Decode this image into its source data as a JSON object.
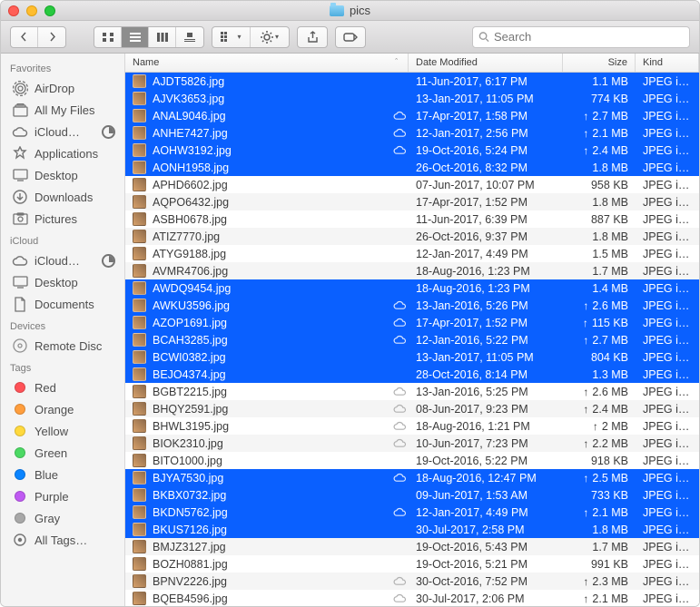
{
  "window": {
    "title": "pics"
  },
  "search": {
    "placeholder": "Search"
  },
  "columns": {
    "name": "Name",
    "date": "Date Modified",
    "size": "Size",
    "kind": "Kind"
  },
  "sidebar": {
    "sections": [
      {
        "title": "Favorites",
        "items": [
          {
            "label": "AirDrop",
            "icon": "airdrop"
          },
          {
            "label": "All My Files",
            "icon": "allfiles"
          },
          {
            "label": "iCloud…",
            "icon": "cloud",
            "pie": true
          },
          {
            "label": "Applications",
            "icon": "apps"
          },
          {
            "label": "Desktop",
            "icon": "desktop"
          },
          {
            "label": "Downloads",
            "icon": "downloads"
          },
          {
            "label": "Pictures",
            "icon": "pictures"
          }
        ]
      },
      {
        "title": "iCloud",
        "items": [
          {
            "label": "iCloud…",
            "icon": "cloud",
            "pie": true
          },
          {
            "label": "Desktop",
            "icon": "desktop"
          },
          {
            "label": "Documents",
            "icon": "documents"
          }
        ]
      },
      {
        "title": "Devices",
        "items": [
          {
            "label": "Remote Disc",
            "icon": "disc"
          }
        ]
      },
      {
        "title": "Tags",
        "items": [
          {
            "label": "Red",
            "icon": "tag",
            "color": "#ff5257"
          },
          {
            "label": "Orange",
            "icon": "tag",
            "color": "#ff9e3d"
          },
          {
            "label": "Yellow",
            "icon": "tag",
            "color": "#ffd93d"
          },
          {
            "label": "Green",
            "icon": "tag",
            "color": "#4cd964"
          },
          {
            "label": "Blue",
            "icon": "tag",
            "color": "#0a84ff"
          },
          {
            "label": "Purple",
            "icon": "tag",
            "color": "#bf5af2"
          },
          {
            "label": "Gray",
            "icon": "tag",
            "color": "#a8a8a8"
          },
          {
            "label": "All Tags…",
            "icon": "alltags"
          }
        ]
      }
    ]
  },
  "files": [
    {
      "name": "AJDT5826.jpg",
      "date": "11-Jun-2017, 6:17 PM",
      "size": "1.1 MB",
      "kind": "JPEG ima",
      "sel": true,
      "cloud": false,
      "up": false
    },
    {
      "name": "AJVK3653.jpg",
      "date": "13-Jan-2017, 11:05 PM",
      "size": "774 KB",
      "kind": "JPEG ima",
      "sel": true,
      "cloud": false,
      "up": false
    },
    {
      "name": "ANAL9046.jpg",
      "date": "17-Apr-2017, 1:58 PM",
      "size": "2.7 MB",
      "kind": "JPEG ima",
      "sel": true,
      "cloud": true,
      "up": true
    },
    {
      "name": "ANHE7427.jpg",
      "date": "12-Jan-2017, 2:56 PM",
      "size": "2.1 MB",
      "kind": "JPEG ima",
      "sel": true,
      "cloud": true,
      "up": true
    },
    {
      "name": "AOHW3192.jpg",
      "date": "19-Oct-2016, 5:24 PM",
      "size": "2.4 MB",
      "kind": "JPEG ima",
      "sel": true,
      "cloud": true,
      "up": true
    },
    {
      "name": "AONH1958.jpg",
      "date": "26-Oct-2016, 8:32 PM",
      "size": "1.8 MB",
      "kind": "JPEG ima",
      "sel": true,
      "cloud": false,
      "up": false
    },
    {
      "name": "APHD6602.jpg",
      "date": "07-Jun-2017, 10:07 PM",
      "size": "958 KB",
      "kind": "JPEG ima",
      "sel": false,
      "cloud": false,
      "up": false
    },
    {
      "name": "AQPO6432.jpg",
      "date": "17-Apr-2017, 1:52 PM",
      "size": "1.8 MB",
      "kind": "JPEG ima",
      "sel": false,
      "cloud": false,
      "up": false
    },
    {
      "name": "ASBH0678.jpg",
      "date": "11-Jun-2017, 6:39 PM",
      "size": "887 KB",
      "kind": "JPEG ima",
      "sel": false,
      "cloud": false,
      "up": false
    },
    {
      "name": "ATIZ7770.jpg",
      "date": "26-Oct-2016, 9:37 PM",
      "size": "1.8 MB",
      "kind": "JPEG ima",
      "sel": false,
      "cloud": false,
      "up": false
    },
    {
      "name": "ATYG9188.jpg",
      "date": "12-Jan-2017, 4:49 PM",
      "size": "1.5 MB",
      "kind": "JPEG ima",
      "sel": false,
      "cloud": false,
      "up": false
    },
    {
      "name": "AVMR4706.jpg",
      "date": "18-Aug-2016, 1:23 PM",
      "size": "1.7 MB",
      "kind": "JPEG ima",
      "sel": false,
      "cloud": false,
      "up": false
    },
    {
      "name": "AWDQ9454.jpg",
      "date": "18-Aug-2016, 1:23 PM",
      "size": "1.4 MB",
      "kind": "JPEG ima",
      "sel": true,
      "cloud": false,
      "up": false
    },
    {
      "name": "AWKU3596.jpg",
      "date": "13-Jan-2016, 5:26 PM",
      "size": "2.6 MB",
      "kind": "JPEG ima",
      "sel": true,
      "cloud": true,
      "up": true
    },
    {
      "name": "AZOP1691.jpg",
      "date": "17-Apr-2017, 1:52 PM",
      "size": "115 KB",
      "kind": "JPEG ima",
      "sel": true,
      "cloud": true,
      "up": true
    },
    {
      "name": "BCAH3285.jpg",
      "date": "12-Jan-2016, 5:22 PM",
      "size": "2.7 MB",
      "kind": "JPEG ima",
      "sel": true,
      "cloud": true,
      "up": true
    },
    {
      "name": "BCWI0382.jpg",
      "date": "13-Jan-2017, 11:05 PM",
      "size": "804 KB",
      "kind": "JPEG ima",
      "sel": true,
      "cloud": false,
      "up": false
    },
    {
      "name": "BEJO4374.jpg",
      "date": "28-Oct-2016, 8:14 PM",
      "size": "1.3 MB",
      "kind": "JPEG ima",
      "sel": true,
      "cloud": false,
      "up": false
    },
    {
      "name": "BGBT2215.jpg",
      "date": "13-Jan-2016, 5:25 PM",
      "size": "2.6 MB",
      "kind": "JPEG ima",
      "sel": false,
      "cloud": true,
      "up": true
    },
    {
      "name": "BHQY2591.jpg",
      "date": "08-Jun-2017, 9:23 PM",
      "size": "2.4 MB",
      "kind": "JPEG ima",
      "sel": false,
      "cloud": true,
      "up": true
    },
    {
      "name": "BHWL3195.jpg",
      "date": "18-Aug-2016, 1:21 PM",
      "size": "2 MB",
      "kind": "JPEG ima",
      "sel": false,
      "cloud": true,
      "up": true
    },
    {
      "name": "BIOK2310.jpg",
      "date": "10-Jun-2017, 7:23 PM",
      "size": "2.2 MB",
      "kind": "JPEG ima",
      "sel": false,
      "cloud": true,
      "up": true
    },
    {
      "name": "BITO1000.jpg",
      "date": "19-Oct-2016, 5:22 PM",
      "size": "918 KB",
      "kind": "JPEG ima",
      "sel": false,
      "cloud": false,
      "up": false
    },
    {
      "name": "BJYA7530.jpg",
      "date": "18-Aug-2016, 12:47 PM",
      "size": "2.5 MB",
      "kind": "JPEG ima",
      "sel": true,
      "cloud": true,
      "up": true
    },
    {
      "name": "BKBX0732.jpg",
      "date": "09-Jun-2017, 1:53 AM",
      "size": "733 KB",
      "kind": "JPEG ima",
      "sel": true,
      "cloud": false,
      "up": false
    },
    {
      "name": "BKDN5762.jpg",
      "date": "12-Jan-2017, 4:49 PM",
      "size": "2.1 MB",
      "kind": "JPEG ima",
      "sel": true,
      "cloud": true,
      "up": true
    },
    {
      "name": "BKUS7126.jpg",
      "date": "30-Jul-2017, 2:58 PM",
      "size": "1.8 MB",
      "kind": "JPEG ima",
      "sel": true,
      "cloud": false,
      "up": false
    },
    {
      "name": "BMJZ3127.jpg",
      "date": "19-Oct-2016, 5:43 PM",
      "size": "1.7 MB",
      "kind": "JPEG ima",
      "sel": false,
      "cloud": false,
      "up": false
    },
    {
      "name": "BOZH0881.jpg",
      "date": "19-Oct-2016, 5:21 PM",
      "size": "991 KB",
      "kind": "JPEG ima",
      "sel": false,
      "cloud": false,
      "up": false
    },
    {
      "name": "BPNV2226.jpg",
      "date": "30-Oct-2016, 7:52 PM",
      "size": "2.3 MB",
      "kind": "JPEG ima",
      "sel": false,
      "cloud": true,
      "up": true
    },
    {
      "name": "BQEB4596.jpg",
      "date": "30-Jul-2017, 2:06 PM",
      "size": "2.1 MB",
      "kind": "JPEG ima",
      "sel": false,
      "cloud": true,
      "up": true
    }
  ]
}
